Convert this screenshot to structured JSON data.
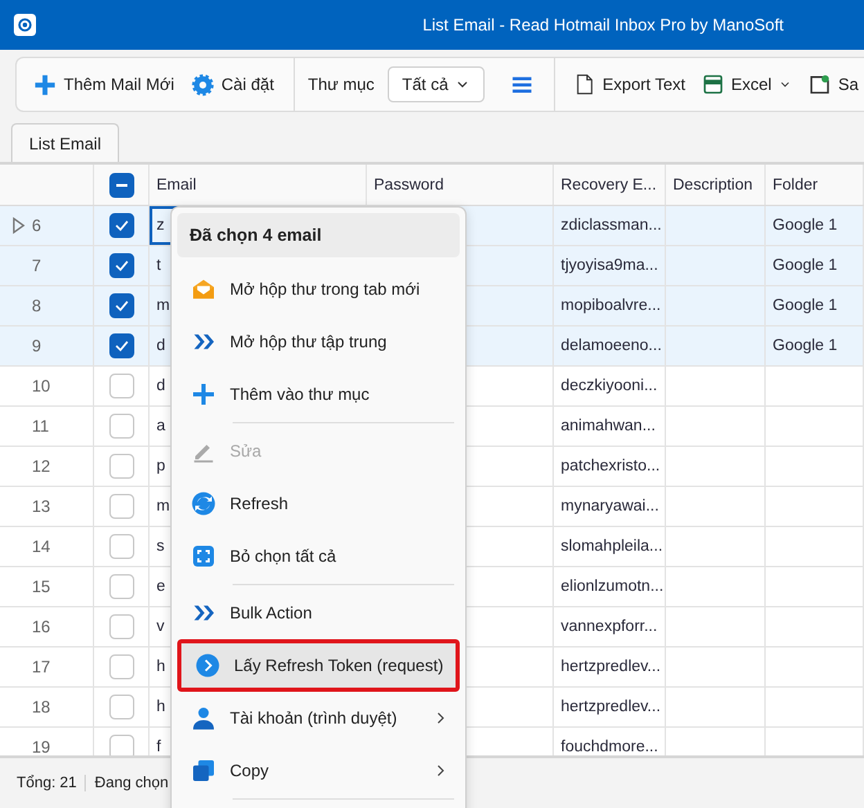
{
  "window": {
    "title": "List Email - Read Hotmail Inbox Pro by ManoSoft"
  },
  "toolbar": {
    "add_button": {
      "label": "Thêm Mail Mới"
    },
    "settings_button": {
      "label": "Cài đặt"
    },
    "folder_label": "Thư mục",
    "folder_select": {
      "value": "Tất cả"
    },
    "export_text_button": {
      "label": "Export Text"
    },
    "excel_button": {
      "label": "Excel"
    },
    "save_button": {
      "label": "Sa"
    }
  },
  "tabs": [
    {
      "label": "List Email",
      "selected": true
    }
  ],
  "table": {
    "header_checkbox": {
      "indeterminate": true
    },
    "columns": [
      "Email",
      "Password",
      "Recovery E...",
      "Description",
      "Folder"
    ],
    "rows": [
      {
        "number": "6",
        "current": true,
        "checked": true,
        "email": "z",
        "recovery": "zdiclassman...",
        "folder": "Google 1"
      },
      {
        "number": "7",
        "current": false,
        "checked": true,
        "email": "t",
        "recovery": "tjyoyisa9ma...",
        "folder": "Google 1"
      },
      {
        "number": "8",
        "current": false,
        "checked": true,
        "email": "m",
        "recovery": "mopiboalvre...",
        "folder": "Google 1"
      },
      {
        "number": "9",
        "current": false,
        "checked": true,
        "email": "d",
        "recovery": "delamoeeno...",
        "folder": "Google 1"
      },
      {
        "number": "10",
        "current": false,
        "checked": false,
        "email": "d",
        "recovery": "deczkiyooni..."
      },
      {
        "number": "11",
        "current": false,
        "checked": false,
        "email": "a",
        "recovery": "animahwan..."
      },
      {
        "number": "12",
        "current": false,
        "checked": false,
        "email": "p",
        "recovery": "patchexristo..."
      },
      {
        "number": "13",
        "current": false,
        "checked": false,
        "email": "m",
        "recovery": "mynaryawai..."
      },
      {
        "number": "14",
        "current": false,
        "checked": false,
        "email": "s",
        "recovery": "slomahpleila..."
      },
      {
        "number": "15",
        "current": false,
        "checked": false,
        "email": "e",
        "recovery": "elionlzumotn..."
      },
      {
        "number": "16",
        "current": false,
        "checked": false,
        "email": "v",
        "recovery": "vannexpforr..."
      },
      {
        "number": "17",
        "current": false,
        "checked": false,
        "email": "h",
        "recovery": "hertzpredlev..."
      },
      {
        "number": "18",
        "current": false,
        "checked": false,
        "email": "h",
        "recovery": "hertzpredlev..."
      },
      {
        "number": "19",
        "current": false,
        "checked": false,
        "email": "f",
        "recovery": "fouchdmore..."
      }
    ]
  },
  "status_bar": {
    "total": "Tổng: 21",
    "selected": "Đang chọn"
  },
  "context_menu": {
    "header": "Đã chọn 4 email",
    "items": [
      {
        "kind": "item",
        "label": "Mở hộp thư trong tab mới",
        "disabled": false,
        "highlighted": false,
        "has_submenu": false
      },
      {
        "kind": "item",
        "label": "Mở hộp thư tập trung",
        "disabled": false,
        "highlighted": false,
        "has_submenu": false
      },
      {
        "kind": "item",
        "label": "Thêm vào thư mục",
        "disabled": false,
        "highlighted": false,
        "has_submenu": false
      },
      {
        "kind": "separator"
      },
      {
        "kind": "item",
        "label": "Sửa",
        "disabled": true,
        "highlighted": false,
        "has_submenu": false
      },
      {
        "kind": "item",
        "label": "Refresh",
        "disabled": false,
        "highlighted": false,
        "has_submenu": false
      },
      {
        "kind": "item",
        "label": "Bỏ chọn tất cả",
        "disabled": false,
        "highlighted": false,
        "has_submenu": false
      },
      {
        "kind": "separator"
      },
      {
        "kind": "item",
        "label": "Bulk Action",
        "disabled": false,
        "highlighted": false,
        "has_submenu": false
      },
      {
        "kind": "item",
        "label": "Lấy Refresh Token (request)",
        "disabled": false,
        "highlighted": true,
        "has_submenu": false
      },
      {
        "kind": "item",
        "label": "Tài khoản (trình duyệt)",
        "disabled": false,
        "highlighted": false,
        "has_submenu": true
      },
      {
        "kind": "item",
        "label": "Copy",
        "disabled": false,
        "highlighted": false,
        "has_submenu": true
      },
      {
        "kind": "separator"
      }
    ]
  }
}
